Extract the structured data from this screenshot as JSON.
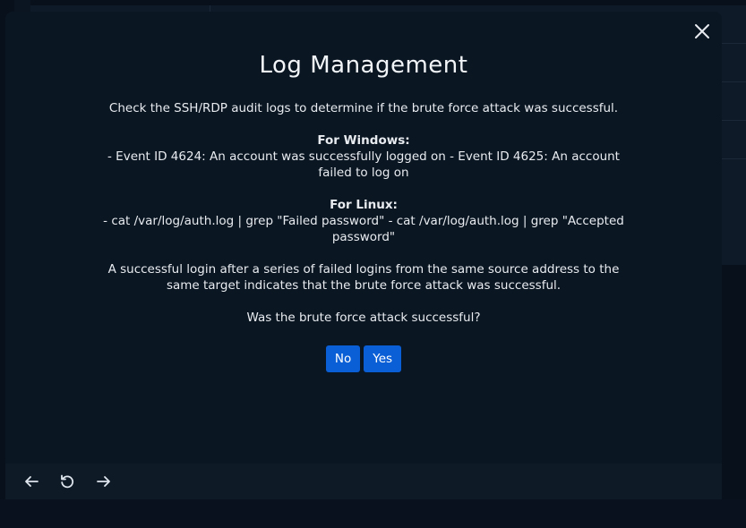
{
  "modal": {
    "title": "Log Management",
    "intro": "Check the SSH/RDP audit logs to determine if the brute force attack was successful.",
    "windows_heading": "For Windows:",
    "windows_text": "- Event ID 4624: An account was successfully logged on - Event ID 4625: An account failed to log on",
    "linux_heading": "For Linux:",
    "linux_text": "- cat /var/log/auth.log | grep \"Failed password\" - cat /var/log/auth.log | grep \"Accepted password\"",
    "explanation": "A successful login after a series of failed logins from the same source address to the same target indicates that the brute force attack was successful.",
    "question": "Was the brute force attack successful?",
    "no_label": "No",
    "yes_label": "Yes"
  },
  "footer": {
    "icons": [
      "arrow-left-icon",
      "refresh-icon",
      "arrow-right-icon"
    ]
  },
  "colors": {
    "modal_bg": "#0b1623",
    "accent": "#0b5fd6",
    "text": "#e8ecf0"
  }
}
